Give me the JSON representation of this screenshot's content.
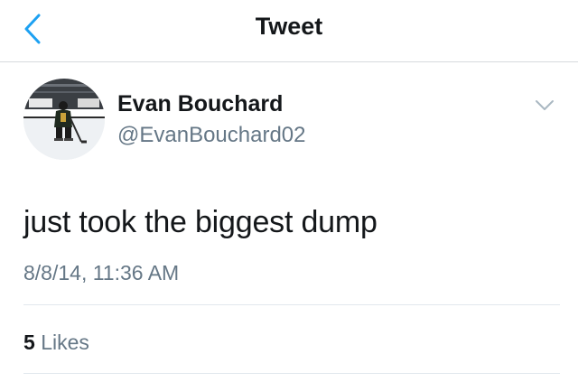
{
  "navbar": {
    "title": "Tweet",
    "back_icon": "chevron-left-icon",
    "accent_color": "#1da1f2"
  },
  "tweet": {
    "author": {
      "display_name": "Evan Bouchard",
      "handle": "@EvanBouchard02"
    },
    "menu_icon": "chevron-down-icon",
    "text": "just took the biggest dump",
    "timestamp": "8/8/14, 11:36 AM",
    "likes": {
      "count": "5",
      "label": "Likes"
    }
  }
}
